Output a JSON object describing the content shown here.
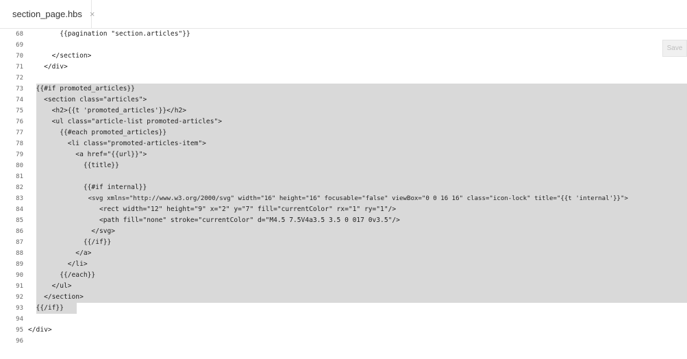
{
  "tab": {
    "filename": "section_page.hbs",
    "close_glyph": "×"
  },
  "toolbar": {
    "save_label": "Save"
  },
  "line_numbers": [
    "68",
    "69",
    "70",
    "71",
    "72",
    "73",
    "74",
    "75",
    "76",
    "77",
    "78",
    "79",
    "80",
    "81",
    "82",
    "83",
    "84",
    "85",
    "86",
    "87",
    "88",
    "89",
    "90",
    "91",
    "92",
    "93",
    "94",
    "95",
    "96"
  ],
  "code": {
    "l68": "        {{pagination \"section.articles\"}}",
    "l69": "",
    "l70": "      </section>",
    "l71": "    </div>",
    "l72": "",
    "l73": "  {{#if promoted_articles}}",
    "l74": "    <section class=\"articles\">",
    "l75": "      <h2>{{t 'promoted_articles'}}</h2>",
    "l76": "      <ul class=\"article-list promoted-articles\">",
    "l77": "        {{#each promoted_articles}}",
    "l78": "          <li class=\"promoted-articles-item\">",
    "l79": "            <a href=\"{{url}}\">",
    "l80": "              {{title}}",
    "l81": "",
    "l82": "              {{#if internal}}",
    "l83": "                <svg xmlns=\"http://www.w3.org/2000/svg\" width=\"16\" height=\"16\" focusable=\"false\" viewBox=\"0 0 16 16\" class=\"icon-lock\" title=\"{{t 'internal'}}\">",
    "l84": "                  <rect width=\"12\" height=\"9\" x=\"2\" y=\"7\" fill=\"currentColor\" rx=\"1\" ry=\"1\"/>",
    "l85": "                  <path fill=\"none\" stroke=\"currentColor\" d=\"M4.5 7.5V4a3.5 3.5 0 017 0v3.5\"/>",
    "l86": "                </svg>",
    "l87": "              {{/if}}",
    "l88": "            </a>",
    "l89": "          </li>",
    "l90": "        {{/each}}",
    "l91": "      </ul>",
    "l92": "    </section>",
    "l93": "  {{/if}}",
    "l94": "",
    "l95": "</div>",
    "l96": ""
  }
}
